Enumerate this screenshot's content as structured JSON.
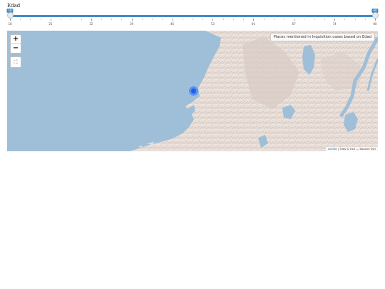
{
  "slider": {
    "label": "Edad",
    "min": 18,
    "max": 60,
    "from": 18,
    "to": 60,
    "from_label": "18",
    "to_label": "60",
    "tick_labels": [
      "18",
      "25",
      "32",
      "39",
      "46",
      "53",
      "60",
      "67",
      "74",
      "80"
    ],
    "accent_color": "#428bca"
  },
  "map": {
    "title": "Places mentioned in Inquisition cases based on Edad",
    "zoom_in_label": "+",
    "zoom_out_label": "−",
    "fullscreen_icon": "fullscreen-icon",
    "marker_color": "#1c5ff5",
    "water_color": "#9fbfd9",
    "land_color": "#e7dcd6",
    "attribution": {
      "link": "Leaflet",
      "rest": " | Tiles © Esri — Source: Esri"
    }
  }
}
